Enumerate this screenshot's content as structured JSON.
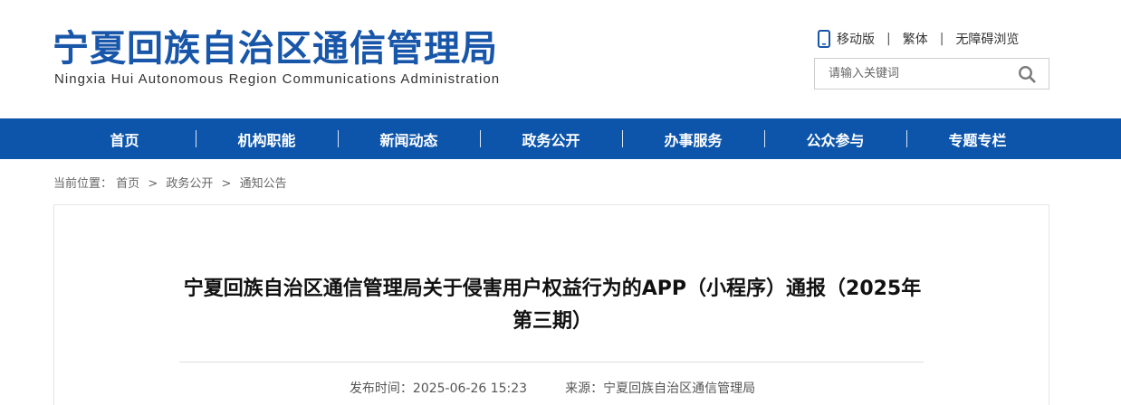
{
  "header": {
    "title": "宁夏回族自治区通信管理局",
    "subtitle": "Ningxia Hui Autonomous Region Communications Administration",
    "links": {
      "mobile": "移动版",
      "traditional": "繁体",
      "accessible": "无障碍浏览",
      "separator": "|"
    },
    "search": {
      "placeholder": "请输入关键词",
      "icon": "search-icon"
    },
    "mobile_icon": "phone-icon",
    "brand_color": "#1856a9"
  },
  "nav": {
    "items": [
      "首页",
      "机构职能",
      "新闻动态",
      "政务公开",
      "办事服务",
      "公众参与",
      "专题专栏"
    ],
    "background": "#0c55ab"
  },
  "breadcrumb": {
    "label": "当前位置：",
    "items": [
      "首页",
      "政务公开",
      "通知公告"
    ],
    "arrow": ">"
  },
  "article": {
    "title": "宁夏回族自治区通信管理局关于侵害用户权益行为的APP（小程序）通报（2025年第三期）",
    "publish_time": "发布时间：2025-06-26 15:23",
    "source": "来源：宁夏回族自治区通信管理局"
  }
}
